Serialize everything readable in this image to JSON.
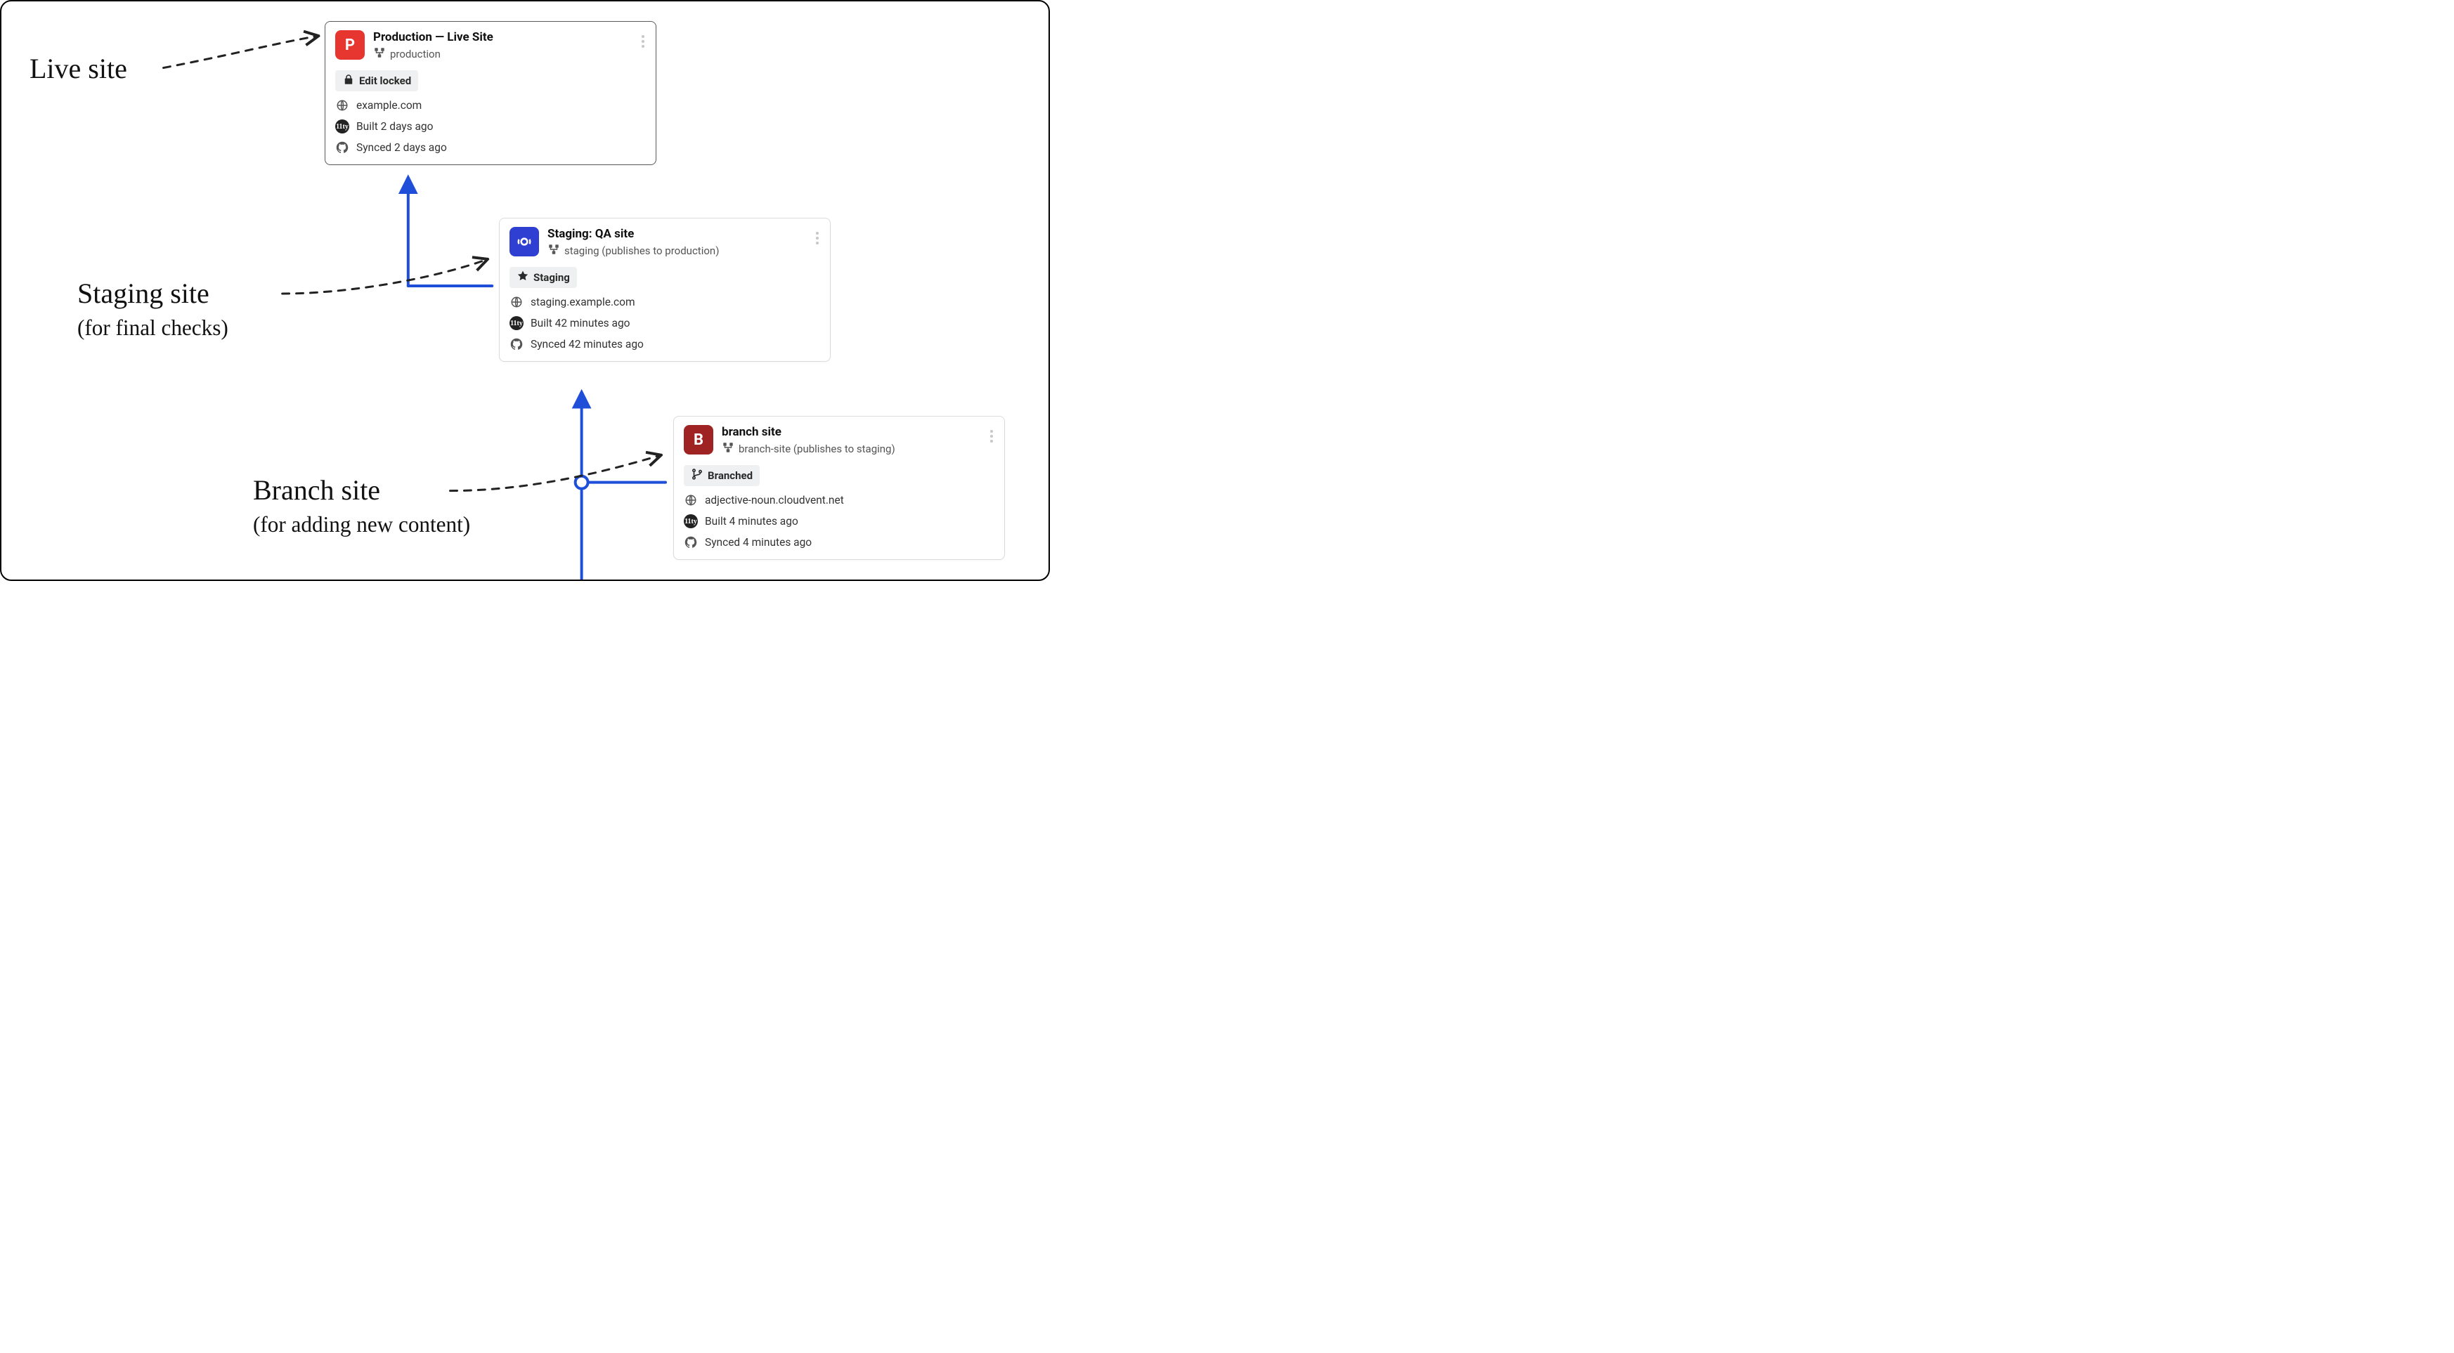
{
  "labels": {
    "live": {
      "title": "Live site"
    },
    "staging": {
      "title": "Staging site",
      "sub": "(for final checks)"
    },
    "branch": {
      "title": "Branch site",
      "sub": "(for adding new content)"
    }
  },
  "cards": {
    "prod": {
      "badge_letter": "P",
      "title": "Production — Live Site",
      "branch": "production",
      "tag": "Edit locked",
      "domain": "example.com",
      "built": "Built 2 days ago",
      "synced": "Synced 2 days ago"
    },
    "staging": {
      "title": "Staging: QA site",
      "branch": "staging (publishes to production)",
      "tag": "Staging",
      "domain": "staging.example.com",
      "built": "Built 42 minutes ago",
      "synced": "Synced 42 minutes ago"
    },
    "branch": {
      "badge_letter": "B",
      "title": "branch site",
      "branch": "branch-site (publishes to staging)",
      "tag": "Branched",
      "domain": "adjective-noun.cloudvent.net",
      "built": "Built 4 minutes ago",
      "synced": "Synced 4 minutes ago"
    }
  },
  "icons": {
    "eleventy": "11ty"
  }
}
